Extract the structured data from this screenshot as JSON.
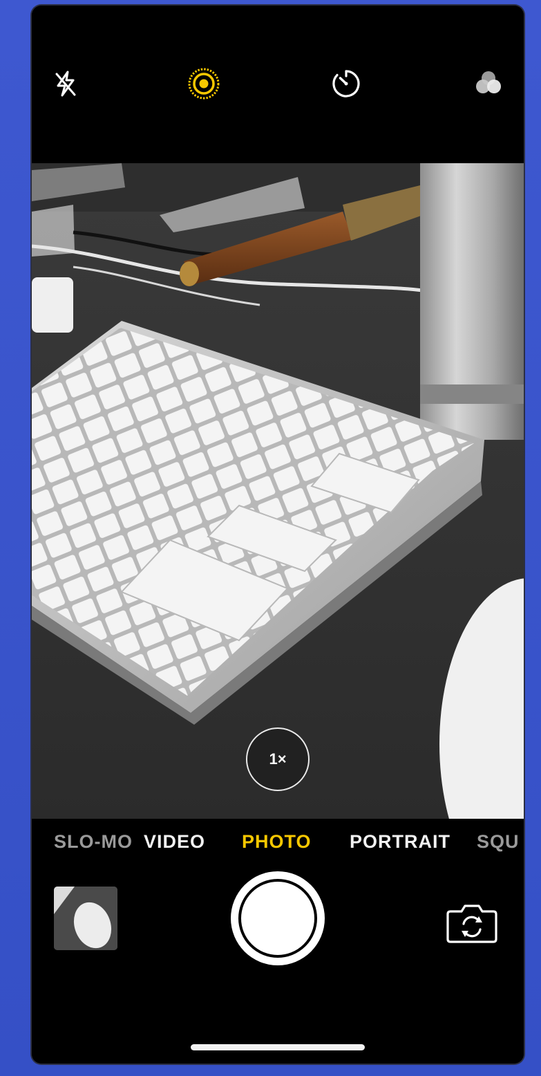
{
  "app": "Camera",
  "top_controls": {
    "flash": "flash-off-icon",
    "live_photo": "live-photo-icon",
    "live_photo_color": "#f8c800",
    "timer": "timer-icon",
    "filters": "filters-icon"
  },
  "viewfinder": {
    "zoom_label": "1×"
  },
  "modes": {
    "items": [
      "SLO-MO",
      "VIDEO",
      "PHOTO",
      "PORTRAIT",
      "SQU"
    ],
    "active": "PHOTO",
    "active_color": "#f8c800"
  },
  "bottom_controls": {
    "last_photo": "last-photo-thumbnail",
    "shutter": "shutter-button",
    "flip_camera": "flip-camera-icon"
  }
}
